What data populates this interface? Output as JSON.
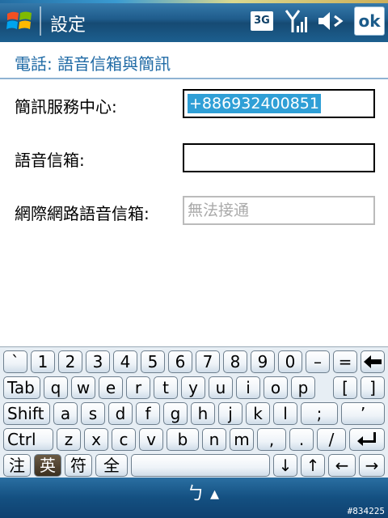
{
  "title_bar": {
    "app_title": "設定",
    "network_label": "3G",
    "ok_label": "ok"
  },
  "header": {
    "title": "電話: 語音信箱與簡訊"
  },
  "form": {
    "fields": [
      {
        "label": "簡訊服務中心:",
        "value": "+886932400851"
      },
      {
        "label": "語音信箱:",
        "value": ""
      },
      {
        "label": "網際網路語音信箱:",
        "value": "無法接通"
      }
    ]
  },
  "keyboard": {
    "rows": [
      [
        "`",
        "1",
        "2",
        "3",
        "4",
        "5",
        "6",
        "7",
        "8",
        "9",
        "0",
        "–",
        "=",
        "backspace"
      ],
      [
        "Tab",
        "q",
        "w",
        "e",
        "r",
        "t",
        "y",
        "u",
        "i",
        "o",
        "p",
        "[",
        "]"
      ],
      [
        "Shift",
        "a",
        "s",
        "d",
        "f",
        "g",
        "h",
        "j",
        "k",
        "l",
        ";",
        "’"
      ],
      [
        "Ctrl",
        "z",
        "x",
        "c",
        "v",
        "b",
        "n",
        "m",
        ",",
        ".",
        "/",
        "enter"
      ],
      [
        "注",
        "英",
        "符",
        "全",
        "space",
        "↓",
        "↑",
        "←",
        "→"
      ]
    ],
    "active_key": "英"
  },
  "bottom_bar": {
    "input_method_label": "ㄅ ▴",
    "watermark": "#834225"
  },
  "colors": {
    "title_bar": "#1f5c8c",
    "header_text": "#1f6aa5",
    "selection": "#2f9fd6"
  }
}
